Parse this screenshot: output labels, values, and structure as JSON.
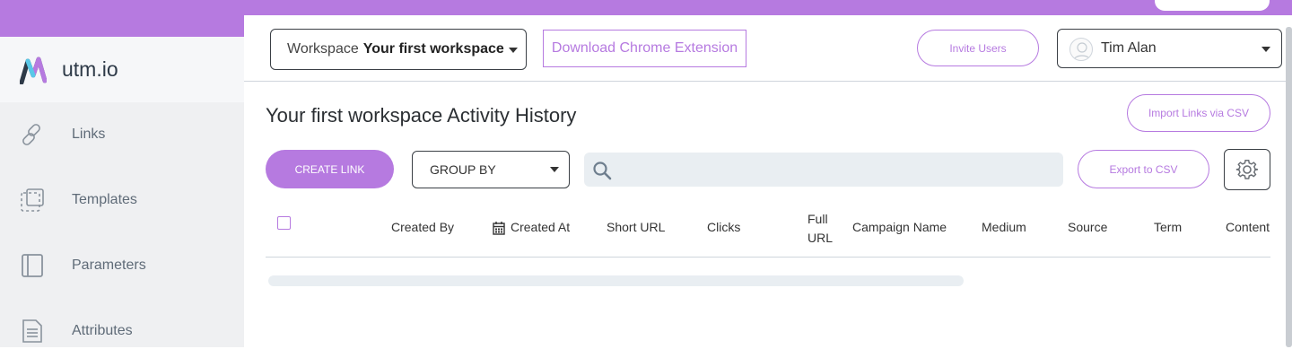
{
  "brand": {
    "name": "utm.io"
  },
  "sidebar": {
    "items": [
      {
        "label": "Links",
        "icon": "link-icon"
      },
      {
        "label": "Templates",
        "icon": "template-icon"
      },
      {
        "label": "Parameters",
        "icon": "parameters-icon"
      },
      {
        "label": "Attributes",
        "icon": "document-icon"
      }
    ]
  },
  "header": {
    "workspace_prefix": "Workspace",
    "workspace_name": "Your first workspace",
    "chrome_extension_label": "Download Chrome Extension",
    "invite_label": "Invite Users",
    "user_name": "Tim Alan"
  },
  "main": {
    "title": "Your first workspace Activity History",
    "import_label": "Import Links via CSV",
    "create_label": "CREATE LINK",
    "group_by_label": "GROUP BY",
    "search_placeholder": "",
    "export_label": "Export to CSV"
  },
  "table": {
    "columns": [
      "Created By",
      "Created At",
      "Short URL",
      "Clicks",
      "Full URL",
      "Campaign Name",
      "Medium",
      "Source",
      "Term",
      "Content"
    ]
  },
  "colors": {
    "accent": "#b67ae0",
    "sidebar_bg": "#eff0f2",
    "search_bg": "#e9eef2"
  }
}
